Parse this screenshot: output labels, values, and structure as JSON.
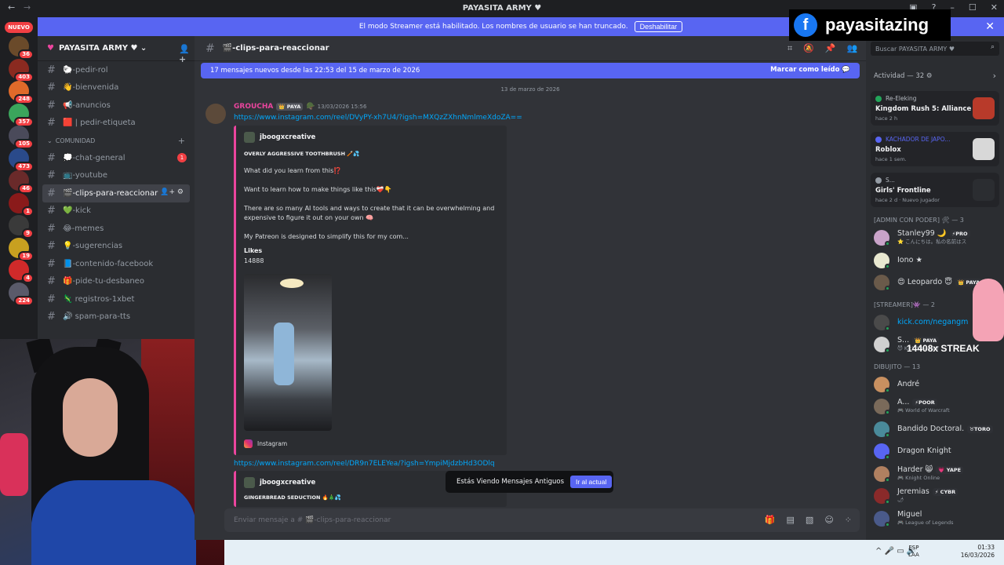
{
  "window": {
    "title": "PAYASITA ARMY ♥",
    "back": "←",
    "forward": "→"
  },
  "overlay": {
    "facebook_glyph": "f",
    "brand": "payasitazing",
    "streak": "14408x STREAK"
  },
  "banner": {
    "text": "El modo Streamer está habilitado. Los nombres de usuario se han truncado.",
    "button": "Deshabilitar",
    "close": "✕"
  },
  "servers": {
    "nuevo": "NUEVO",
    "list": [
      {
        "color": "#6a4a2a",
        "badge": "36"
      },
      {
        "color": "#8a2a20",
        "badge": "403"
      },
      {
        "color": "#e06a2a",
        "badge": "248"
      },
      {
        "color": "#3ba55c",
        "badge": "357"
      },
      {
        "color": "#4a4a5a",
        "badge": "105"
      },
      {
        "color": "#2a4a8a",
        "badge": "473"
      },
      {
        "color": "#6a2a2a",
        "badge": "46"
      },
      {
        "color": "#8a1a1a",
        "badge": "1"
      },
      {
        "color": "#3a3a3a",
        "badge": "9"
      },
      {
        "color": "#c8a020",
        "badge": "19"
      },
      {
        "color": "#d02a2a",
        "badge": "4"
      },
      {
        "color": "#5a5a6a",
        "badge": "224"
      }
    ]
  },
  "guild": {
    "name": "PAYASITA ARMY ♥ ⌄",
    "channels_top": [
      {
        "label": "🐑-pedir-rol"
      },
      {
        "label": "👋-bienvenida"
      },
      {
        "label": "📢-anuncios"
      },
      {
        "label": "🟥 | pedir-etiqueta"
      }
    ],
    "category": "COMUNIDAD",
    "channels": [
      {
        "label": "💭-chat-general",
        "badge": "1"
      },
      {
        "label": "📺-youtube"
      },
      {
        "label": "🎬-clips-para-reaccionar",
        "active": true
      },
      {
        "label": "💚-kick"
      },
      {
        "label": "😂-memes"
      },
      {
        "label": "💡-sugerencias"
      },
      {
        "label": "📘-contenido-facebook"
      },
      {
        "label": "🎁-pide-tu-desbaneo"
      },
      {
        "label": "🦎 registros-1xbet"
      },
      {
        "label": "🔊 spam-para-tts"
      }
    ]
  },
  "chat": {
    "channel": "🎬-clips-para-reaccionar",
    "new_messages": "17 mensajes nuevos desde las 22:53 del 15 de marzo de 2026",
    "mark_read": "Marcar como leído",
    "date": "13 de marzo de 2026",
    "message": {
      "author": "GROUCHA",
      "tag": "👑 PAYA",
      "time": "13/03/2026 15:56",
      "link1": "https://www.instagram.com/reel/DVyPY-xh7U4/?igsh=MXQzZXhnNmlmeXdoZA==",
      "embed": {
        "author": "jboogxcreative",
        "title": "OVERLY AGGRESSIVE TOOTHBRUSH 🪥💦",
        "line1": "What did you learn from this⁉️",
        "line2": "Want to learn how to make things like this❤️‍🩹👇",
        "line3": "There are so many AI tools and ways to create that it can be overwhelming and expensive to figure it out on your own 🧠",
        "line4": "My Patreon is designed to simplify this for my com...",
        "likes_label": "Likes",
        "likes_value": "14888",
        "footer": "Instagram"
      },
      "link2": "https://www.instagram.com/reel/DR9n7ELEYea/?igsh=YmpiMjdzbHd3ODlq",
      "embed2": {
        "author": "jboogxcreative",
        "title": "GINGERBREAD SEDUCTION 🔥🎄💦"
      }
    },
    "old_notice": "Estás Viendo Mensajes Antiguos",
    "jump": "Ir al actual",
    "composer_placeholder": "Enviar mensaje a # 🎬-clips-para-reaccionar"
  },
  "members": {
    "search_placeholder": "Buscar PAYASITA ARMY ♥",
    "activity_title": "Actividad — 32 ⚙",
    "activities": [
      {
        "user": "Re-Eleking",
        "game": "Kingdom Rush 5: Alliance TD",
        "when": "hace 2 h",
        "dot": "#23a55a"
      },
      {
        "user": "KACHADOR DE JAPO...",
        "game": "Roblox",
        "when": "hace 1 sem.",
        "dot": "#5865f2"
      },
      {
        "user": "S...",
        "game": "Girls' Frontline",
        "when": "hace 2 d · Nuevo jugador",
        "dot": "#949ba4"
      }
    ],
    "groups": [
      {
        "title": "[ADMIN CON PODER] 🛠 — 3",
        "members": [
          {
            "name": "Stanley99 🌙",
            "tag": "⚡PRO",
            "sub": "⭐ こんにちは。私の名前はス",
            "color": "#c9a3c9"
          },
          {
            "name": "Iono ★",
            "sub": "",
            "color": "#e8e8d0"
          },
          {
            "name": "😍 Leopardo 😇",
            "tag": "👑 PAYA",
            "sub": "",
            "color": "#6a5a4a"
          }
        ]
      },
      {
        "title": "[STREAMER]👾 — 2",
        "members": [
          {
            "name": "kick.com/negangm",
            "sub": "",
            "color": "#4a4a4a"
          },
          {
            "name": "S...",
            "tag": "👑 PAYA",
            "sub": "😈 Kick/SmallJeff",
            "color": "#d0d0d0"
          }
        ]
      },
      {
        "title": "DIBUJITO — 13",
        "members": [
          {
            "name": "André",
            "sub": "",
            "color": "#c89060"
          },
          {
            "name": "A...",
            "tag": "⚡POOR",
            "sub": "🎮 World of Warcraft",
            "color": "#7a6a5a"
          },
          {
            "name": "Bandido Doctoral.",
            "tag": "♉TORO",
            "sub": "",
            "color": "#4a8a9a"
          },
          {
            "name": "Dragon Knight",
            "sub": "",
            "color": "#5865f2"
          },
          {
            "name": "Harder 😸",
            "tag": "💗 YAPE",
            "sub": "🎮 Knight Online",
            "color": "#b08060"
          },
          {
            "name": "Jeremias",
            "tag": "⚡ CYBR",
            "sub": "🌶",
            "color": "#8a2a2a"
          },
          {
            "name": "Miguel",
            "sub": "🎮 League of Legends",
            "color": "#4a5a8a"
          }
        ]
      }
    ]
  },
  "taskbar": {
    "lang1": "ESP",
    "lang2": "LAA",
    "time": "01:33",
    "date": "16/03/2026",
    "tray": "^  🎤  ▭  🔊"
  }
}
